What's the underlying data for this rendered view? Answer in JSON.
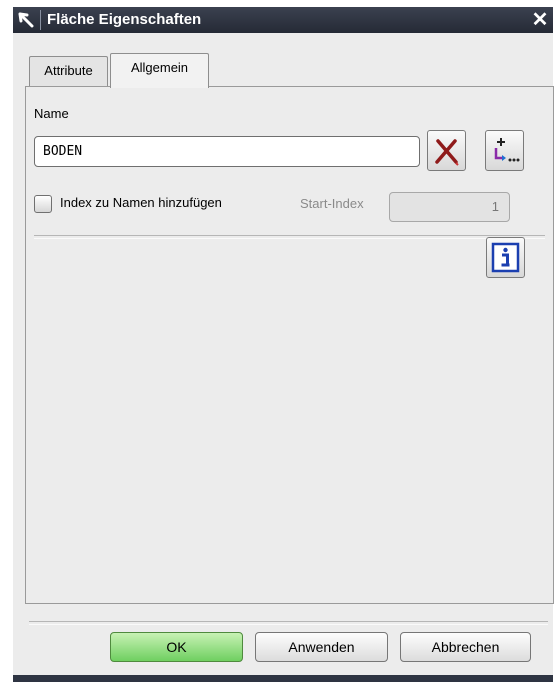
{
  "window": {
    "title": "Fläche Eigenschaften",
    "close_symbol": "✕"
  },
  "tabs": [
    {
      "label": "Attribute",
      "active": false
    },
    {
      "label": "Allgemein",
      "active": true
    }
  ],
  "general": {
    "name_label": "Name",
    "name_value": "BODEN",
    "clear_icon": "red-x-delete-icon",
    "increment_icon": "add-increment-icon",
    "index_checkbox_label": "Index zu Namen hinzufügen",
    "index_checked": false,
    "start_index_label": "Start-Index",
    "start_index_value": "1",
    "info_icon": "info-icon"
  },
  "buttons": {
    "ok": "OK",
    "apply": "Anwenden",
    "cancel": "Abbrechen"
  },
  "colors": {
    "titlebar": "#2b303c",
    "ok_button": "#7ed46a",
    "clear_icon": "#9b1c1c",
    "info_icon": "#1b3fb0"
  }
}
